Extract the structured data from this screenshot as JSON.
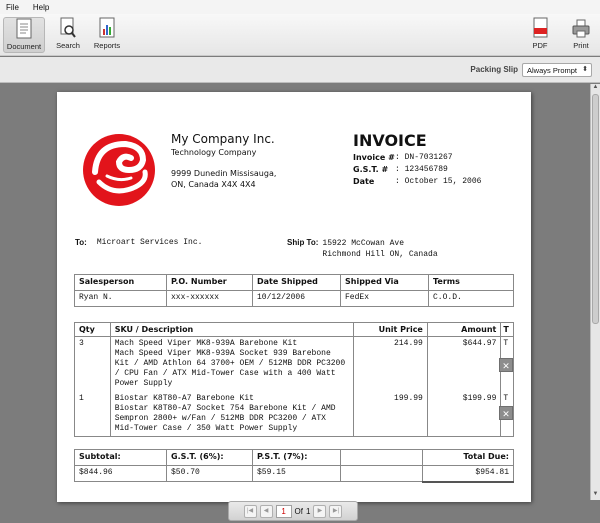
{
  "menu": {
    "file": "File",
    "help": "Help"
  },
  "toolbar": {
    "document": "Document",
    "search": "Search",
    "reports": "Reports",
    "pdf": "PDF",
    "print": "Print"
  },
  "subbar": {
    "label": "Packing Slip",
    "select_value": "Always Prompt"
  },
  "company": {
    "name": "My Company Inc.",
    "tagline": "Technology Company",
    "address1": "9999 Dunedin Missisauga,",
    "address2": "ON, Canada X4X 4X4"
  },
  "invoice": {
    "title": "INVOICE",
    "number_label": "Invoice #",
    "number": ": DN-7031267",
    "gst_label": "G.S.T. #",
    "gst": ": 123456789",
    "date_label": "Date",
    "date": ": October 15, 2006"
  },
  "to": {
    "label": "To:",
    "value": "Microart Services Inc."
  },
  "ship_to": {
    "label": "Ship To:",
    "line1": "15922 McCowan Ave",
    "line2": "Richmond Hill ON, Canada"
  },
  "shipping_table": {
    "headers": [
      "Salesperson",
      "P.O. Number",
      "Date Shipped",
      "Shipped Via",
      "Terms"
    ],
    "row": [
      "Ryan N.",
      "xxx-xxxxxx",
      "10/12/2006",
      "FedEx",
      "C.O.D."
    ]
  },
  "items_table": {
    "headers": [
      "Qty",
      "SKU / Description",
      "Unit Price",
      "Amount",
      "T"
    ],
    "rows": [
      {
        "qty": "3",
        "desc1": "Mach Speed Viper MK8-939A Barebone Kit",
        "desc2": "Mach Speed Viper MK8-939A Socket 939 Barebone Kit / AMD Athlon 64 3700+ OEM / 512MB DDR PC3200 / CPU Fan / ATX Mid-Tower Case with a 400 Watt Power Supply",
        "unit_price": "214.99",
        "amount": "$644.97",
        "t": "T"
      },
      {
        "qty": "1",
        "desc1": "Biostar K8T80-A7 Barebone Kit",
        "desc2": "Biostar K8T80-A7 Socket 754 Barebone Kit / AMD Sempron 2800+ w/Fan / 512MB DDR PC3200 / ATX Mid-Tower Case / 350 Watt Power Supply",
        "unit_price": "199.99",
        "amount": "$199.99",
        "t": "T"
      }
    ],
    "delete_glyph": "✕"
  },
  "totals": {
    "subtotal_label": "Subtotal:",
    "gst_label": "G.S.T. (6%):",
    "pst_label": "P.S.T. (7%):",
    "total_label": "Total Due:",
    "subtotal": "$844.96",
    "gst": "$50.70",
    "pst": "$59.15",
    "total": "$954.81"
  },
  "pager": {
    "current": "1",
    "of": "Of",
    "total": "1"
  },
  "colors": {
    "logo_red": "#e2141b",
    "toolbar_bg": "#ececec",
    "workspace": "#7c7c7c"
  }
}
